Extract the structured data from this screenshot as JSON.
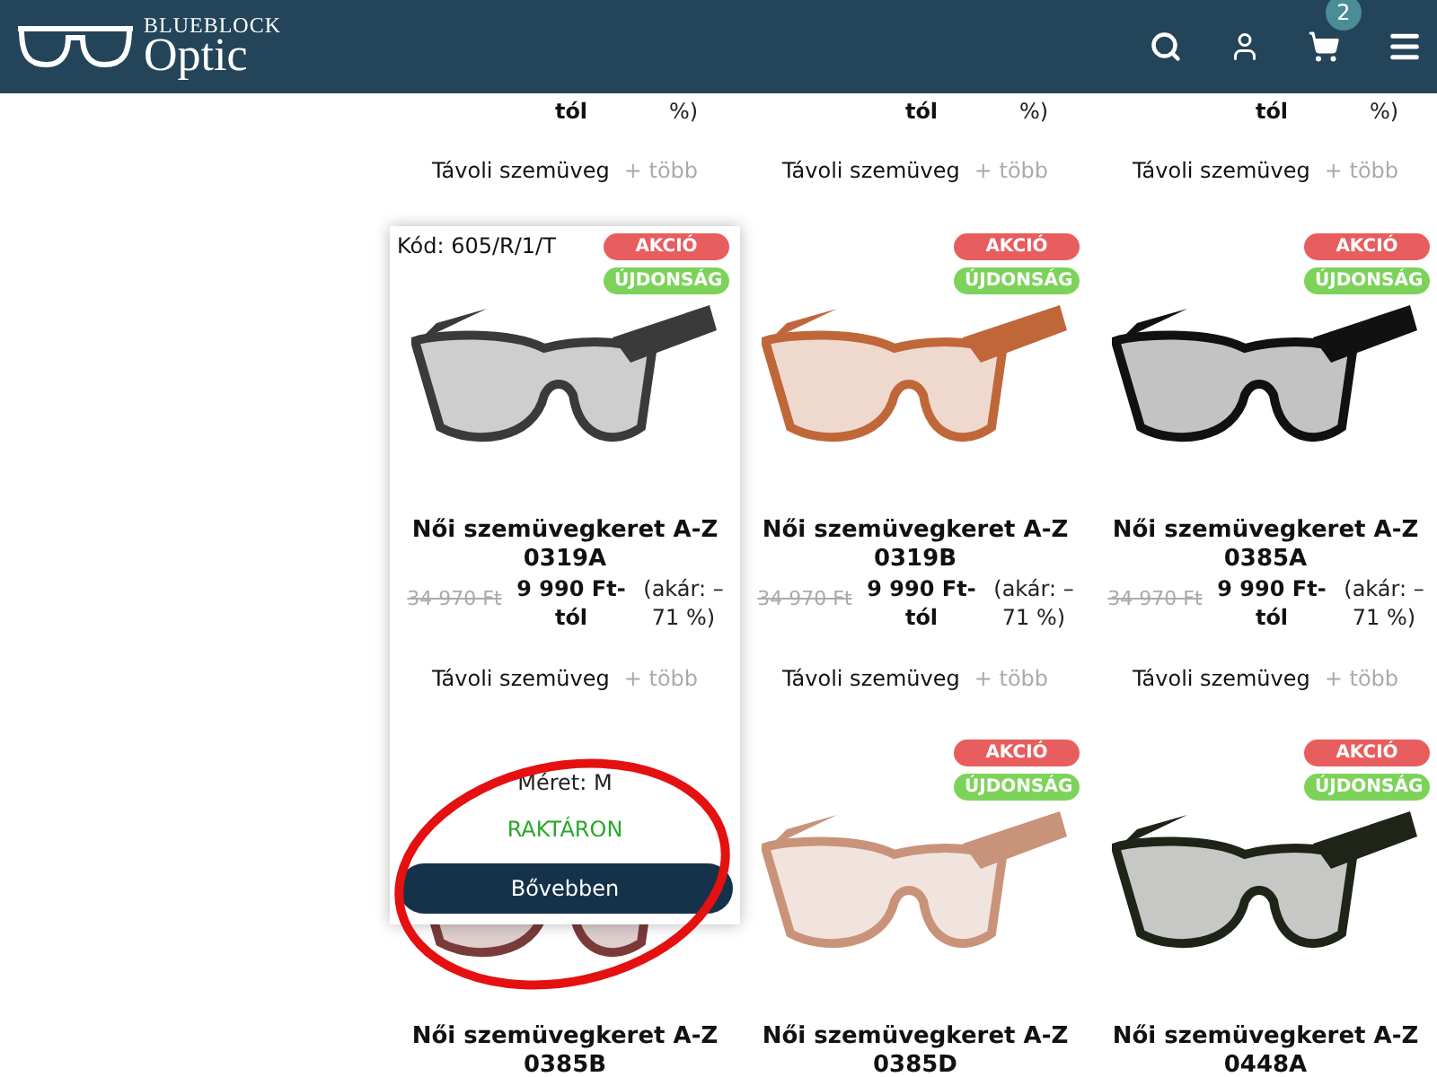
{
  "header": {
    "logo_top": "BLUEBLOCK",
    "logo_bottom": "Optic",
    "cart_count": "2"
  },
  "rows": [
    {
      "products": [
        {
          "price_tail": "tól",
          "discount_tail": "%)",
          "category": "Távoli szemüveg",
          "more": "+ több"
        },
        {
          "price_tail": "tól",
          "discount_tail": "%)",
          "category": "Távoli szemüveg",
          "more": "+ több"
        },
        {
          "price_tail": "tól",
          "discount_tail": "%)",
          "category": "Távoli szemüveg",
          "more": "+ több"
        }
      ]
    },
    {
      "products": [
        {
          "code": "Kód: 605/R/1/T",
          "title": "Női szemüvegkeret A-Z",
          "model": "0319A",
          "old_price": "34 970 Ft",
          "price": "9 990 Ft-tól",
          "discount": "(akár: –71 %)",
          "category": "Távoli szemüveg",
          "more": "+ több",
          "color": "#3a3a3a",
          "badges": [
            {
              "label": "AKCIÓ",
              "kind": "sale"
            },
            {
              "label": "ÚJDONSÁG",
              "kind": "new"
            }
          ],
          "panel": {
            "size": "Méret: M",
            "stock": "RAKTÁRON",
            "button": "Bővebben"
          }
        },
        {
          "title": "Női szemüvegkeret A-Z",
          "model": "0319B",
          "old_price": "34 970 Ft",
          "price": "9 990 Ft-tól",
          "discount": "(akár: –71 %)",
          "category": "Távoli szemüveg",
          "more": "+ több",
          "color": "#c0673a",
          "badges": [
            {
              "label": "AKCIÓ",
              "kind": "sale"
            },
            {
              "label": "ÚJDONSÁG",
              "kind": "new"
            }
          ]
        },
        {
          "title": "Női szemüvegkeret A-Z",
          "model": "0385A",
          "old_price": "34 970 Ft",
          "price": "9 990 Ft-tól",
          "discount": "(akár: –71 %)",
          "category": "Távoli szemüveg",
          "more": "+ több",
          "color": "#111111",
          "badges": [
            {
              "label": "AKCIÓ",
              "kind": "sale"
            },
            {
              "label": "ÚJDONSÁG",
              "kind": "new"
            }
          ]
        }
      ]
    },
    {
      "products": [
        {
          "title": "Női szemüvegkeret A-Z",
          "model": "0385B",
          "color": "#7a3a3a"
        },
        {
          "title": "Női szemüvegkeret A-Z",
          "model": "0385D",
          "color": "#c9937a",
          "badges": [
            {
              "label": "AKCIÓ",
              "kind": "sale"
            },
            {
              "label": "ÚJDONSÁG",
              "kind": "new"
            }
          ]
        },
        {
          "title": "Női szemüvegkeret A-Z",
          "model": "0448A",
          "color": "#1e2418",
          "badges": [
            {
              "label": "AKCIÓ",
              "kind": "sale"
            },
            {
              "label": "ÚJDONSÁG",
              "kind": "new"
            }
          ]
        }
      ]
    }
  ]
}
